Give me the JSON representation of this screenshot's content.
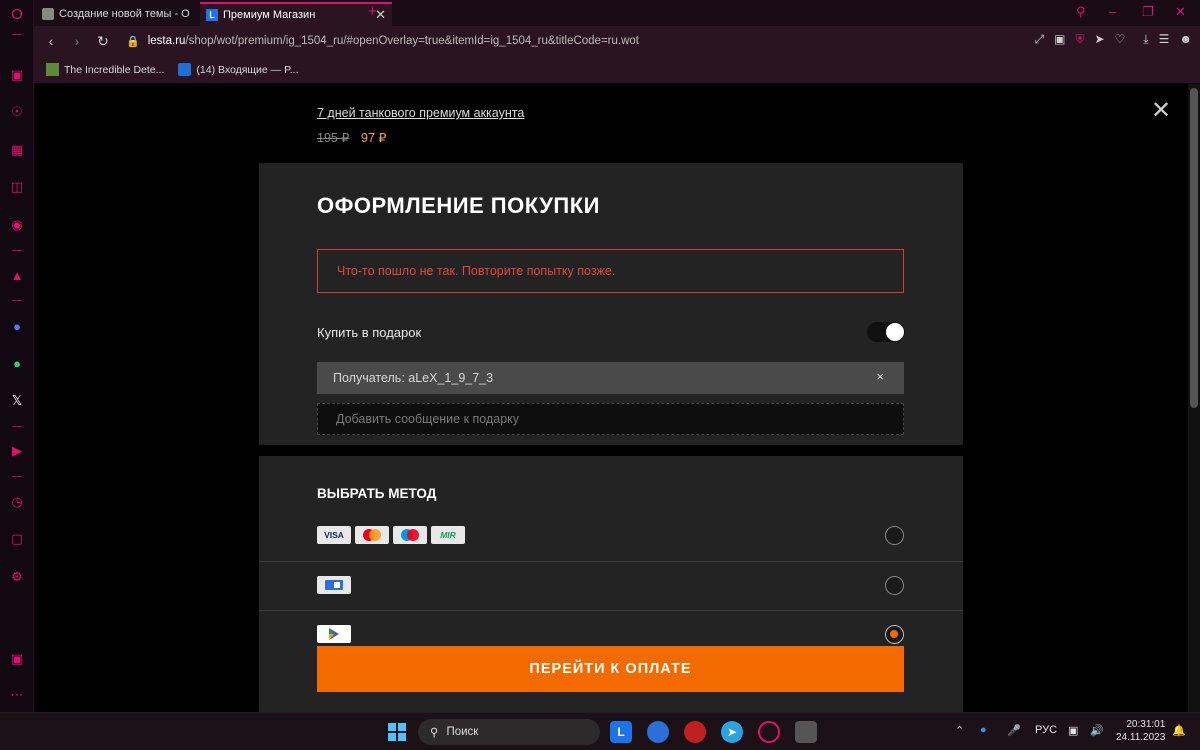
{
  "colors": {
    "accent": "#e0116c",
    "orange": "#f26a00",
    "error": "#e5473c"
  },
  "sidebar": {
    "icons": [
      "opera-logo-icon",
      "gamepad-icon",
      "speed-dial-icon",
      "bag-icon",
      "twitch-icon",
      "instagram-icon",
      "aria-icon",
      "messenger-icon",
      "whatsapp-icon",
      "x-icon",
      "player-icon",
      "history-icon",
      "cube-icon",
      "settings-icon",
      "gallery-icon",
      "more-icon"
    ]
  },
  "tabs": [
    {
      "title": "Создание новой темы - О",
      "active": false
    },
    {
      "title": "Премиум Магазин",
      "active": true
    }
  ],
  "address": {
    "domain": "lesta.ru",
    "path": "/shop/wot/premium/ig_1504_ru/#openOverlay=true&itemId=ig_1504_ru&titleCode=ru.wot"
  },
  "bookmarks": [
    {
      "label": "The Incredible Dete..."
    },
    {
      "label": "(14) Входящие — P..."
    }
  ],
  "product": {
    "name": "7 дней танкового премиум аккаунта",
    "old_price": "195 ₽",
    "new_price": "97 ₽"
  },
  "checkout": {
    "title": "ОФОРМЛЕНИЕ ПОКУПКИ",
    "error": "Что-то пошло не так. Повторите попытку позже.",
    "gift_label": "Купить в подарок",
    "gift_enabled": true,
    "recipient": "Получатель: aLeX_1_9_7_3",
    "clear": "×",
    "message_placeholder": "Добавить сообщение к подарку"
  },
  "payment": {
    "title": "ВЫБРАТЬ МЕТОД",
    "cards": [
      "VISA",
      "MIR"
    ],
    "selected_index": 2,
    "pay_button": "ПЕРЕЙТИ К ОПЛАТЕ"
  },
  "taskbar": {
    "search": "Поиск",
    "lang": "РУС",
    "time": "20:31:01",
    "date": "24.11.2023"
  }
}
